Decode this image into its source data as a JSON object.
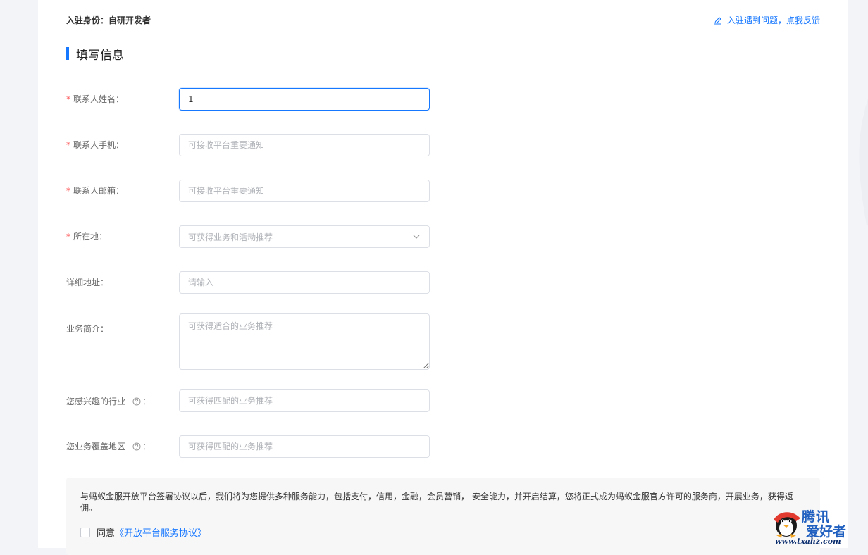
{
  "header": {
    "identity_label": "入驻身份：自研开发者",
    "feedback_link": "入驻遇到问题，点我反馈"
  },
  "section": {
    "title": "填写信息"
  },
  "form": {
    "contact_name": {
      "label": "联系人姓名：",
      "required": true,
      "value": "1"
    },
    "contact_phone": {
      "label": "联系人手机：",
      "required": true,
      "placeholder": "可接收平台重要通知"
    },
    "contact_email": {
      "label": "联系人邮箱：",
      "required": true,
      "placeholder": "可接收平台重要通知"
    },
    "location": {
      "label": "所在地：",
      "required": true,
      "placeholder": "可获得业务和活动推荐"
    },
    "address": {
      "label": "详细地址：",
      "placeholder": "请输入"
    },
    "business_intro": {
      "label": "业务简介：",
      "placeholder": "可获得适合的业务推荐"
    },
    "industry": {
      "label": "您感兴趣的行业",
      "suffix": "：",
      "placeholder": "可获得匹配的业务推荐"
    },
    "coverage": {
      "label": "您业务覆盖地区",
      "suffix": "：",
      "placeholder": "可获得匹配的业务推荐"
    },
    "required_mark": "*"
  },
  "agreement": {
    "text": "与蚂蚁金服开放平台签署协议以后，我们将为您提供多种服务能力，包括支付，信用，金融，会员营销， 安全能力，并开启结算，您将正式成为蚂蚁金服官方许可的服务商，开展业务，获得返佣。",
    "agree_label": "同意",
    "link_text": "《开放平台服务协议》",
    "checked": false
  },
  "watermark": {
    "title": "腾讯",
    "subtitle": "爱好者",
    "url": "www.txahz.com"
  },
  "colors": {
    "primary": "#1677ff",
    "required": "#ff4d4f",
    "background": "#f3f4f8"
  }
}
